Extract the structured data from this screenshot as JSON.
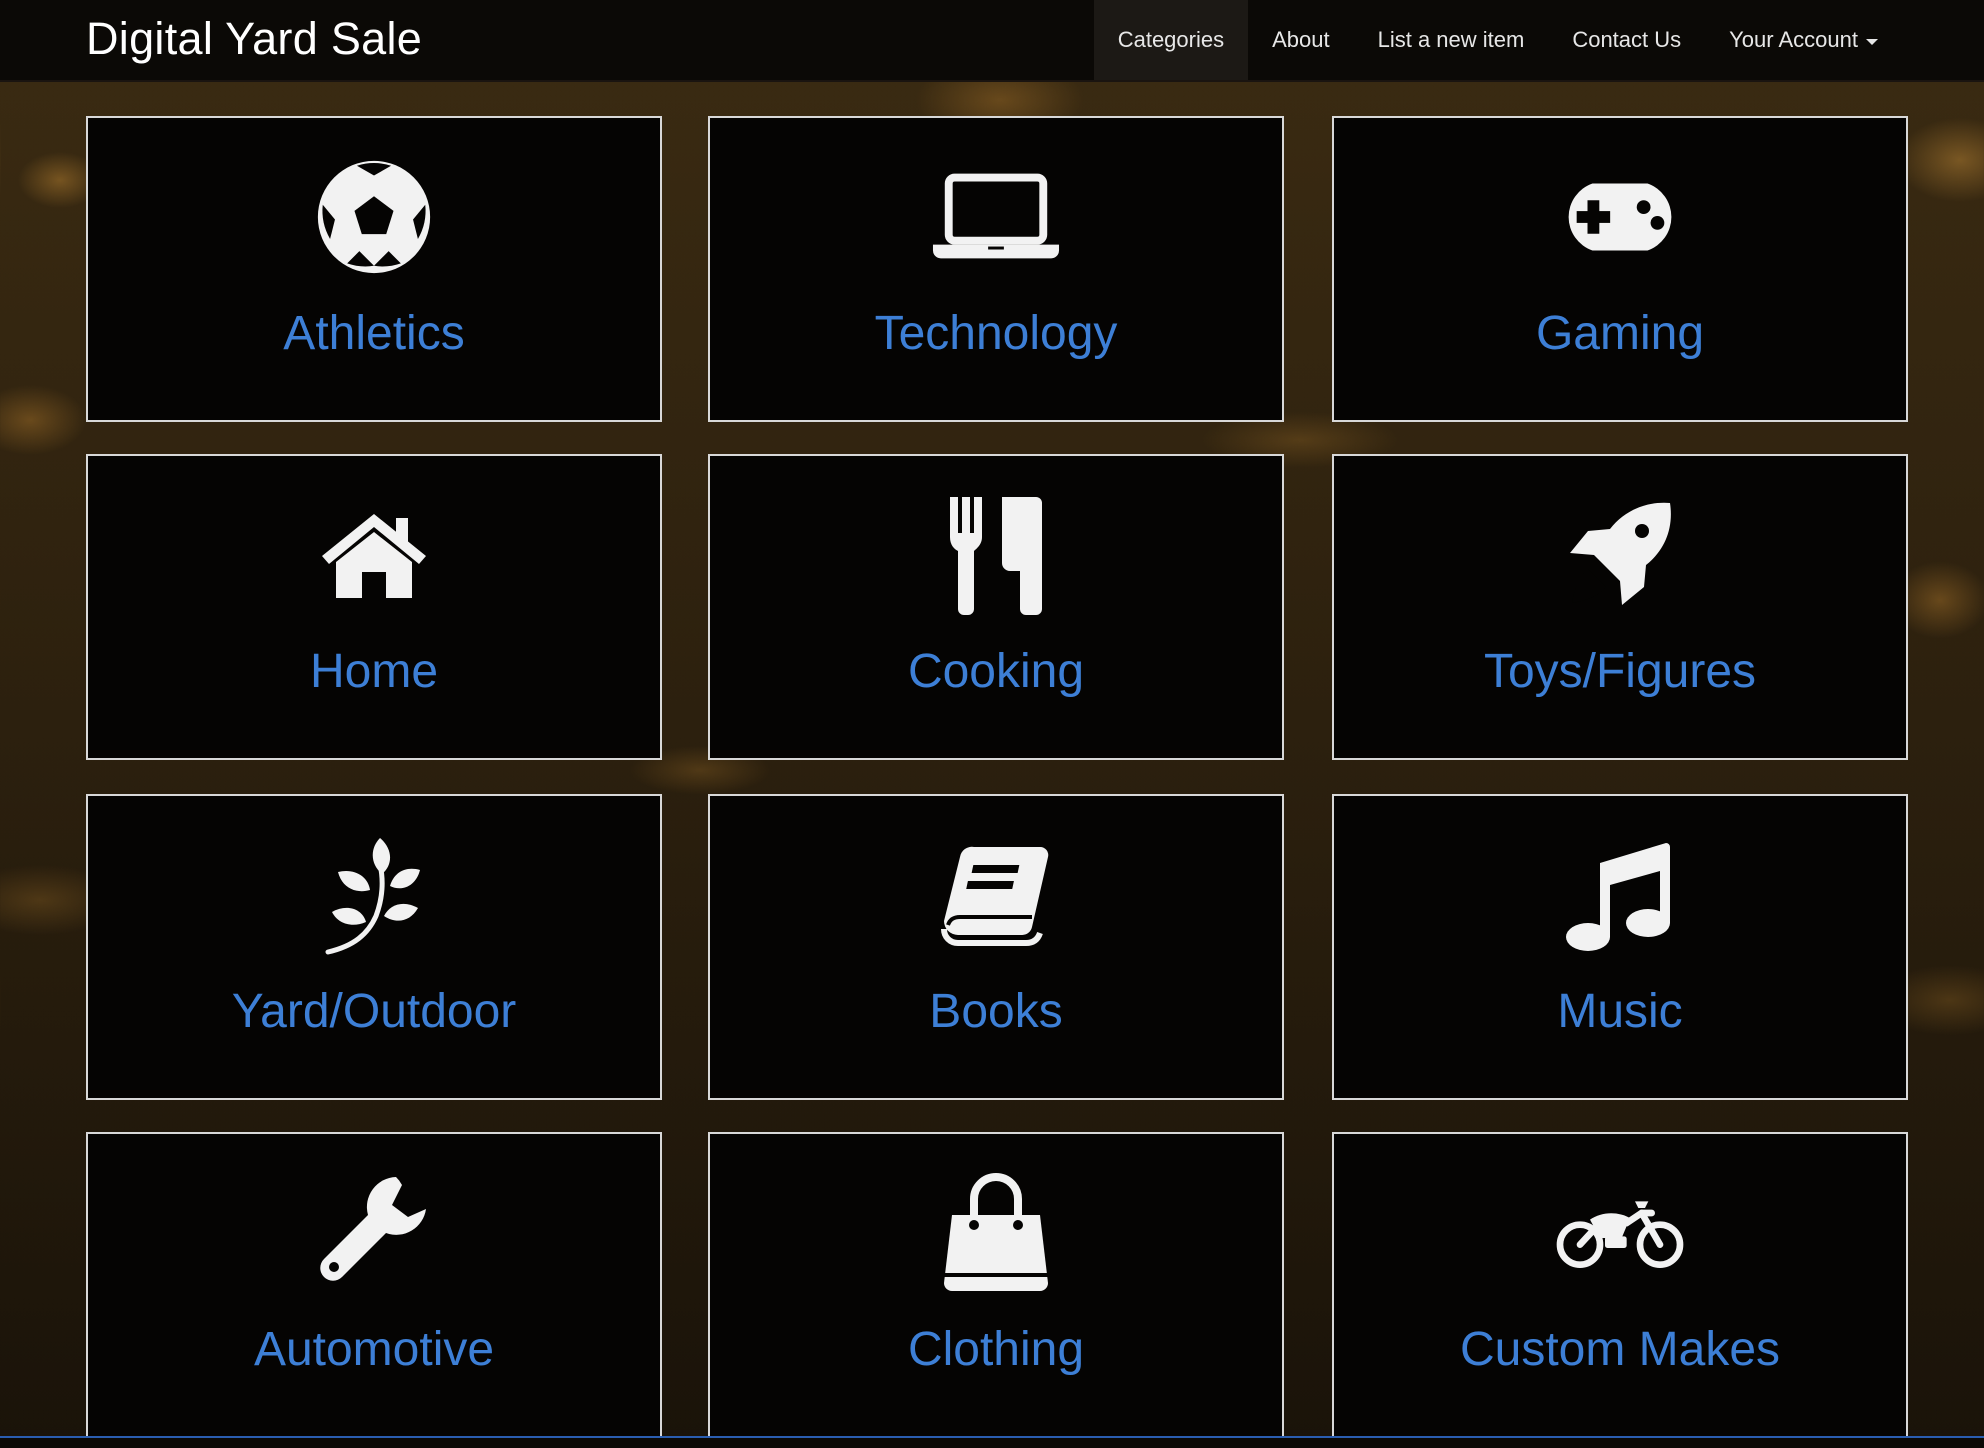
{
  "navbar": {
    "brand": "Digital Yard Sale",
    "items": [
      {
        "label": "Categories",
        "active": true
      },
      {
        "label": "About"
      },
      {
        "label": "List a new item"
      },
      {
        "label": "Contact Us"
      },
      {
        "label": "Your Account",
        "dropdown": true
      }
    ]
  },
  "categories": [
    {
      "label": "Athletics",
      "icon": "soccer-ball-icon"
    },
    {
      "label": "Technology",
      "icon": "laptop-icon"
    },
    {
      "label": "Gaming",
      "icon": "gamepad-icon"
    },
    {
      "label": "Home",
      "icon": "house-icon"
    },
    {
      "label": "Cooking",
      "icon": "fork-knife-icon"
    },
    {
      "label": "Toys/Figures",
      "icon": "rocket-icon"
    },
    {
      "label": "Yard/Outdoor",
      "icon": "leaf-branch-icon"
    },
    {
      "label": "Books",
      "icon": "book-icon"
    },
    {
      "label": "Music",
      "icon": "music-note-icon"
    },
    {
      "label": "Automotive",
      "icon": "wrench-icon"
    },
    {
      "label": "Clothing",
      "icon": "shopping-bag-icon"
    },
    {
      "label": "Custom Makes",
      "icon": "motorcycle-icon"
    }
  ],
  "colors": {
    "accent": "#3d7fd6",
    "tile_bg": "#050403",
    "tile_border": "#d8d8d8",
    "icon": "#f2f2f2"
  }
}
